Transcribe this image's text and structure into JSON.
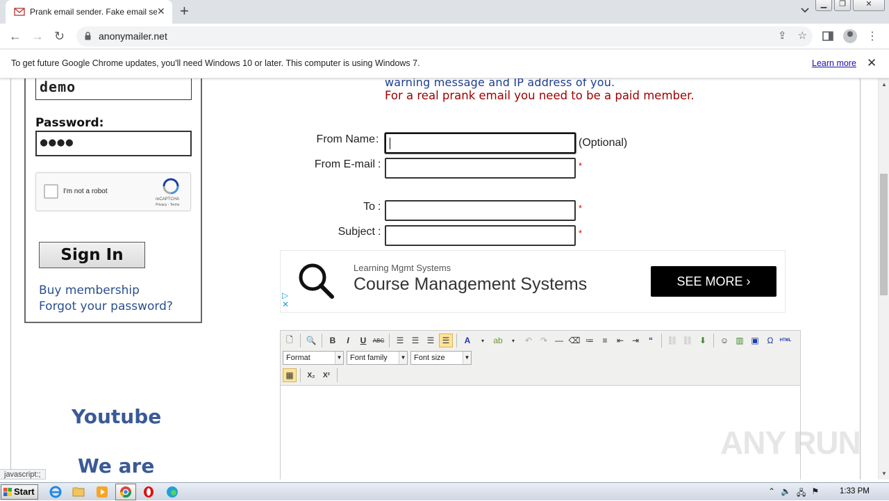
{
  "browser": {
    "tab_title": "Prank email sender. Fake email send",
    "tab_close": "✕",
    "new_tab": "+",
    "url": "anonymailer.net",
    "infobar_message": "To get future Google Chrome updates, you'll need Windows 10 or later. This computer is using Windows 7.",
    "infobar_link": "Learn more",
    "infobar_close": "✕",
    "status_text": "javascript:;"
  },
  "login": {
    "username_value": "demo",
    "password_label": "Password:",
    "password_value": "●●●●",
    "captcha_text": "I'm not a robot",
    "captcha_brand": "reCAPTCHA",
    "captcha_terms": "Privacy - Terms",
    "signin_label": "Sign In",
    "buy_membership": "Buy membership",
    "forgot_password": "Forgot your password?"
  },
  "sidebar": {
    "youtube": "Youtube",
    "we_are": "We are"
  },
  "notice": {
    "line1": "warning message and IP address of you.",
    "line2": "For a real prank email you need to be a paid member."
  },
  "form": {
    "from_name_label": "From Name",
    "from_email_label": "From E-mail",
    "to_label": "To",
    "subject_label": "Subject",
    "separator": ":",
    "optional_text": "(Optional)",
    "required_mark": "*"
  },
  "ad": {
    "small_text": "Learning Mgmt Systems",
    "headline": "Course Management Systems",
    "cta": "SEE MORE"
  },
  "editor": {
    "format_select": "Format",
    "font_family_select": "Font family",
    "font_size_select": "Font size",
    "bold": "B",
    "italic": "I",
    "underline": "U",
    "strike": "ABC",
    "omega": "Ω",
    "html": "HTML",
    "subscript": "X₂",
    "superscript": "X²"
  },
  "watermark": "ANY RUN",
  "taskbar": {
    "start": "Start",
    "clock": "1:33 PM"
  }
}
